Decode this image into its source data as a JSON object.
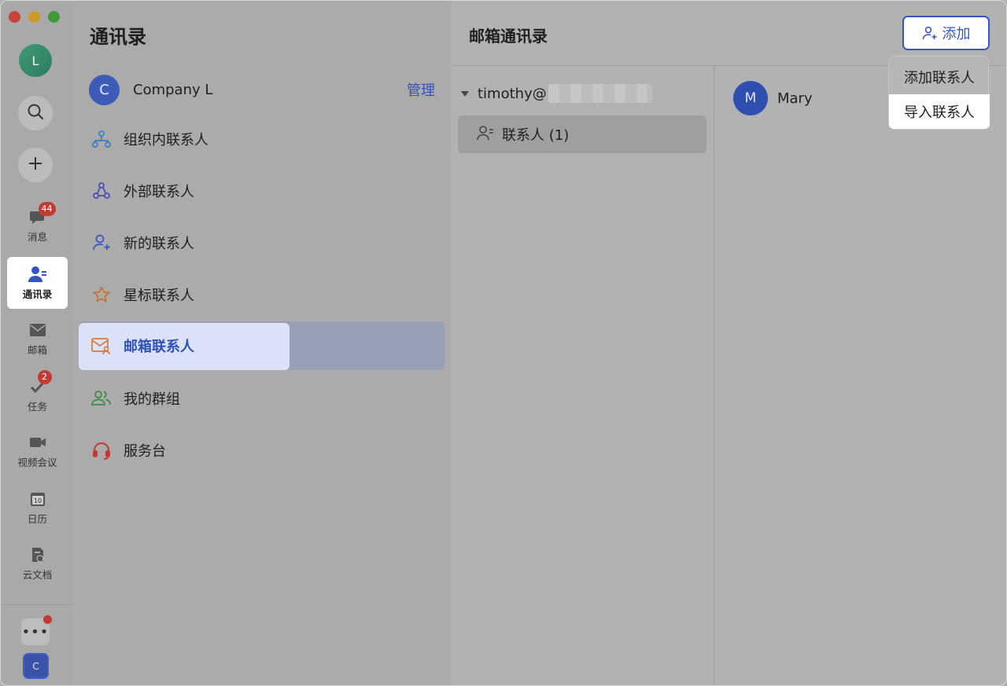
{
  "rail": {
    "user_avatar": "L",
    "badges": {
      "messages": "44",
      "tasks": "2"
    },
    "items": [
      {
        "label": "消息"
      },
      {
        "label": "通讯录"
      },
      {
        "label": "邮箱"
      },
      {
        "label": "任务"
      },
      {
        "label": "视频会议"
      },
      {
        "label": "日历"
      },
      {
        "label": "云文档"
      }
    ],
    "calendar_day": "10",
    "more_glyph": "•••",
    "company_tile": "C"
  },
  "nav": {
    "title": "通讯录",
    "org": {
      "avatar": "C",
      "name": "Company L",
      "manage": "管理"
    },
    "items": [
      {
        "label": "组织内联系人",
        "icon": "org-tree-icon",
        "color": "#3b7dc4"
      },
      {
        "label": "外部联系人",
        "icon": "external-contacts-icon",
        "color": "#4a4ab8"
      },
      {
        "label": "新的联系人",
        "icon": "person-add-icon",
        "color": "#3556c2"
      },
      {
        "label": "星标联系人",
        "icon": "star-icon",
        "color": "#c9702a"
      },
      {
        "label": "邮箱联系人",
        "icon": "mail-contact-icon",
        "color": "#d77a3a"
      },
      {
        "label": "我的群组",
        "icon": "group-icon",
        "color": "#3b8a3e"
      },
      {
        "label": "服务台",
        "icon": "headset-icon",
        "color": "#c23a32"
      }
    ]
  },
  "main": {
    "title": "邮箱通讯录",
    "account_label": "timothy@",
    "group_label": "联系人 (1)",
    "contacts": [
      {
        "initial": "M",
        "name": "Mary"
      }
    ],
    "add_button": "添加",
    "menu": {
      "add_contact": "添加联系人",
      "import_contact": "导入联系人"
    }
  },
  "colors": {
    "accent": "#3556c2",
    "badge": "#c23a32"
  }
}
